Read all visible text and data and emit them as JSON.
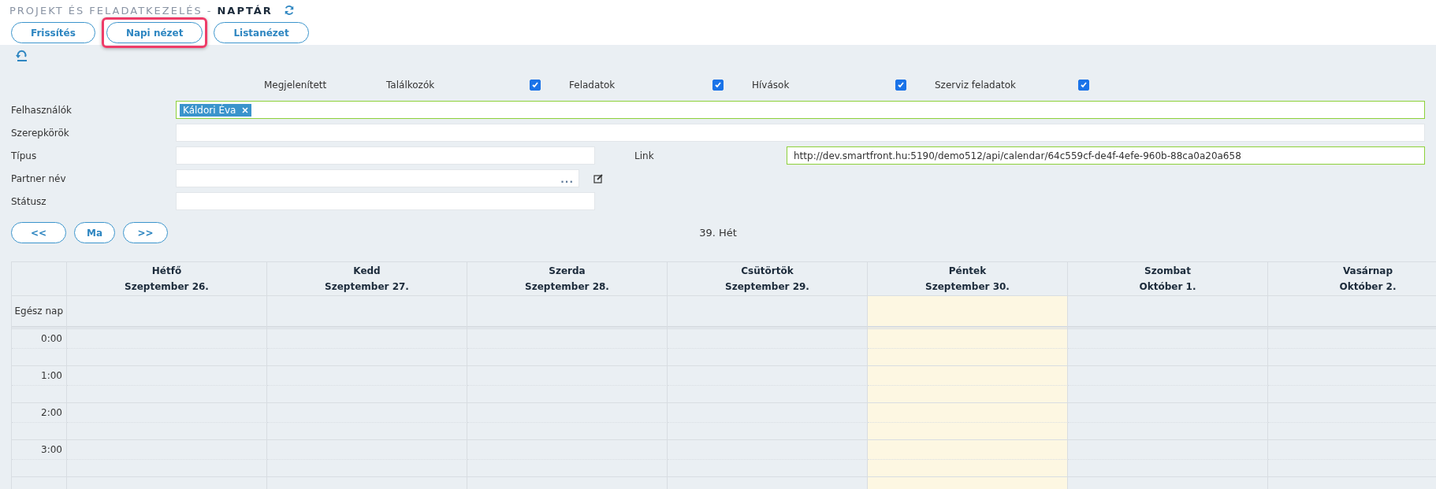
{
  "header": {
    "breadcrumb": "PROJEKT ÉS FELADATKEZELÉS -",
    "title": "NAPTÁR"
  },
  "toolbar": [
    {
      "label": "Frissítés",
      "highlighted": false
    },
    {
      "label": "Napi nézet",
      "highlighted": true
    },
    {
      "label": "Listanézet",
      "highlighted": false
    }
  ],
  "display_filters": {
    "label": "Megjelenített",
    "items": [
      {
        "label": "Találkozók",
        "checked": true
      },
      {
        "label": "Feladatok",
        "checked": true
      },
      {
        "label": "Hívások",
        "checked": true
      },
      {
        "label": "Szerviz feladatok",
        "checked": true
      }
    ]
  },
  "form": {
    "users": {
      "label": "Felhasználók",
      "tags": [
        "Káldori Éva"
      ]
    },
    "roles": {
      "label": "Szerepkörök"
    },
    "type": {
      "label": "Típus"
    },
    "link": {
      "label": "Link",
      "value": "http://dev.smartfront.hu:5190/demo512/api/calendar/64c559cf-de4f-4efe-960b-88ca0a20a658"
    },
    "partner": {
      "label": "Partner név",
      "dots": "..."
    },
    "status": {
      "label": "Státusz"
    }
  },
  "navigation": [
    "<<",
    "Ma",
    ">>"
  ],
  "week_label": "39. Hét",
  "calendar": {
    "all_day_label": "Egész nap",
    "days": [
      {
        "name": "Hétfő",
        "date": "Szeptember 26.",
        "today": false
      },
      {
        "name": "Kedd",
        "date": "Szeptember 27.",
        "today": false
      },
      {
        "name": "Szerda",
        "date": "Szeptember 28.",
        "today": false
      },
      {
        "name": "Csütörtök",
        "date": "Szeptember 29.",
        "today": false
      },
      {
        "name": "Péntek",
        "date": "Szeptember 30.",
        "today": true
      },
      {
        "name": "Szombat",
        "date": "Október 1.",
        "today": false
      },
      {
        "name": "Vasárnap",
        "date": "Október 2.",
        "today": false
      }
    ],
    "hours": [
      "0:00",
      "1:00",
      "2:00",
      "3:00"
    ]
  }
}
